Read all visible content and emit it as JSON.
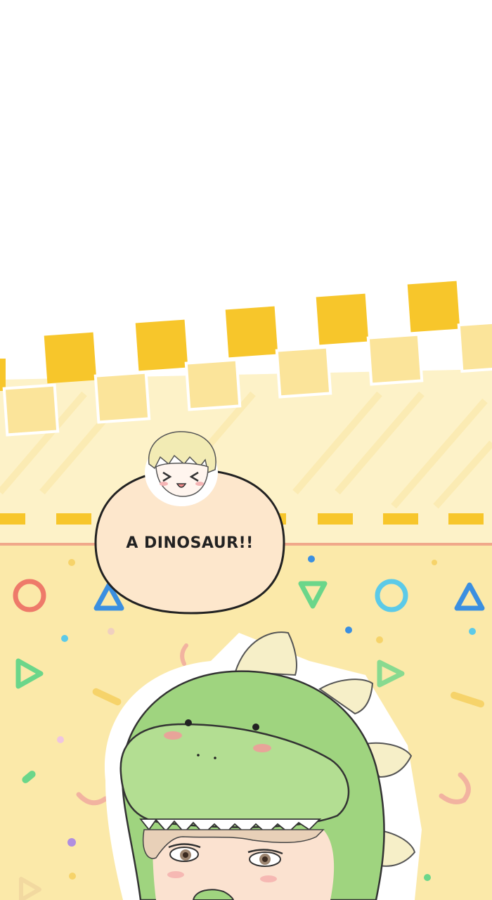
{
  "panel": {
    "speech_text": "A DINOSAUR!!"
  },
  "colors": {
    "checker_bright": "#f7c62b",
    "checker_pale": "#fbe49a",
    "band": "#fdf2c8",
    "lower_bg": "#fbe9a9",
    "stripe_line": "#f0a88a",
    "dino_green": "#9fd47f",
    "spikes": "#f6efc8",
    "bubble_fill": "#fde7cc"
  },
  "icons": [
    "circle-shape-icon",
    "triangle-shape-icon",
    "confetti-dots"
  ]
}
